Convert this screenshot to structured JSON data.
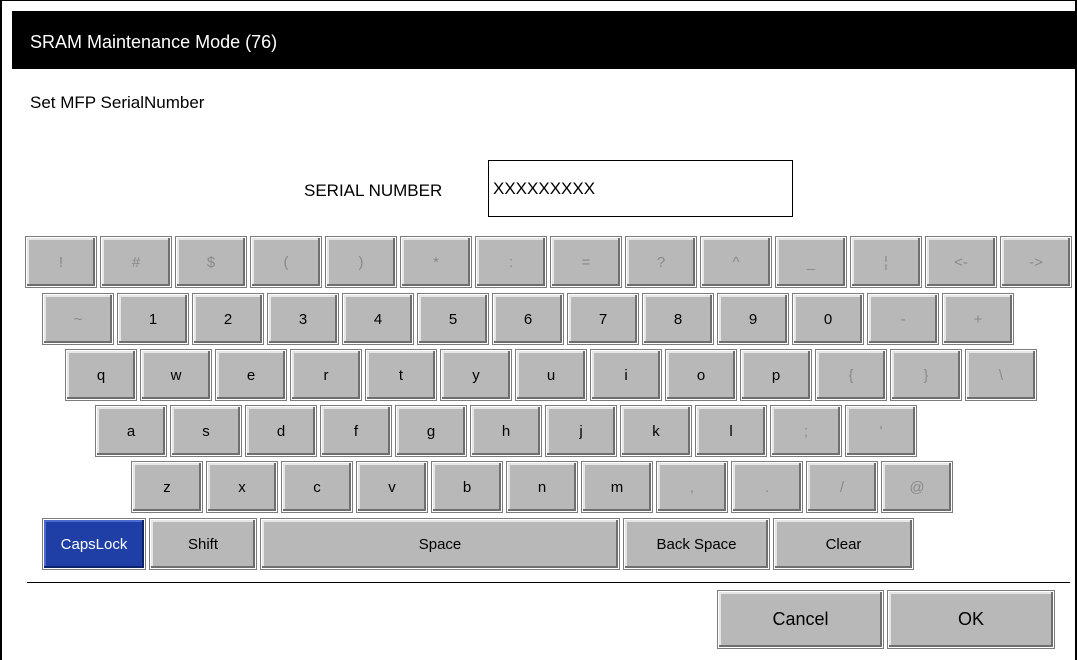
{
  "window": {
    "title": "SRAM Maintenance Mode (76)"
  },
  "prompt": "Set MFP SerialNumber",
  "serial": {
    "label": "SERIAL NUMBER",
    "value": "XXXXXXXXX"
  },
  "keyboard": {
    "rows": [
      [
        "!",
        "#",
        "$",
        "(",
        ")",
        "*",
        ":",
        "=",
        "?",
        "^",
        "_",
        "¦",
        "<-",
        "->"
      ],
      [
        "~",
        "1",
        "2",
        "3",
        "4",
        "5",
        "6",
        "7",
        "8",
        "9",
        "0",
        "-",
        "+"
      ],
      [
        "q",
        "w",
        "e",
        "r",
        "t",
        "y",
        "u",
        "i",
        "o",
        "p",
        "{",
        "}",
        "\\"
      ],
      [
        "a",
        "s",
        "d",
        "f",
        "g",
        "h",
        "j",
        "k",
        "l",
        ";",
        "'"
      ],
      [
        "z",
        "x",
        "c",
        "v",
        "b",
        "n",
        "m",
        ",",
        ".",
        "/",
        "@"
      ]
    ],
    "bottom": {
      "capslock": "CapsLock",
      "shift": "Shift",
      "space": "Space",
      "backspace": "Back Space",
      "clear": "Clear"
    }
  },
  "actions": {
    "cancel": "Cancel",
    "ok": "OK"
  },
  "colors": {
    "key_bg": "#b8b8b8",
    "active_key": "#1f3fa6",
    "titlebar": "#000000"
  }
}
